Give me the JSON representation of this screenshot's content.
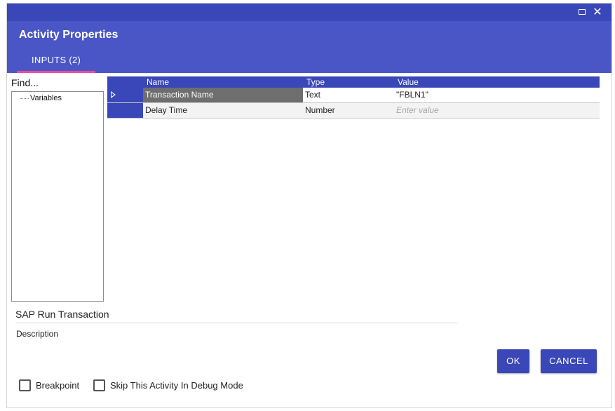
{
  "window": {
    "maximize_icon": "maximize-icon",
    "close_icon": "close-icon",
    "close_glyph": "✕"
  },
  "header": {
    "title": "Activity Properties",
    "tabs": [
      {
        "label": "INPUTS (2)",
        "active": true
      }
    ]
  },
  "sidebar": {
    "find_label": "Find...",
    "tree_items": [
      {
        "label": "Variables"
      }
    ]
  },
  "grid": {
    "columns": [
      "Name",
      "Type",
      "Value"
    ],
    "rows": [
      {
        "name": "Transaction Name",
        "type": "Text",
        "value": "\"FBLN1\"",
        "selected": true
      },
      {
        "name": "Delay Time",
        "type": "Number",
        "value": "",
        "placeholder": "Enter value"
      }
    ]
  },
  "activity": {
    "title": "SAP Run Transaction",
    "description_label": "Description"
  },
  "buttons": {
    "ok_label": "OK",
    "cancel_label": "CANCEL"
  },
  "options": {
    "breakpoint_label": "Breakpoint",
    "breakpoint_checked": false,
    "skip_label": "Skip This Activity In Debug Mode",
    "skip_checked": false
  },
  "colors": {
    "titlebar": "#3a47b8",
    "header": "#4a56c6",
    "accent_tab": "#e94d9d",
    "selected_row": "#6e6e6e"
  }
}
